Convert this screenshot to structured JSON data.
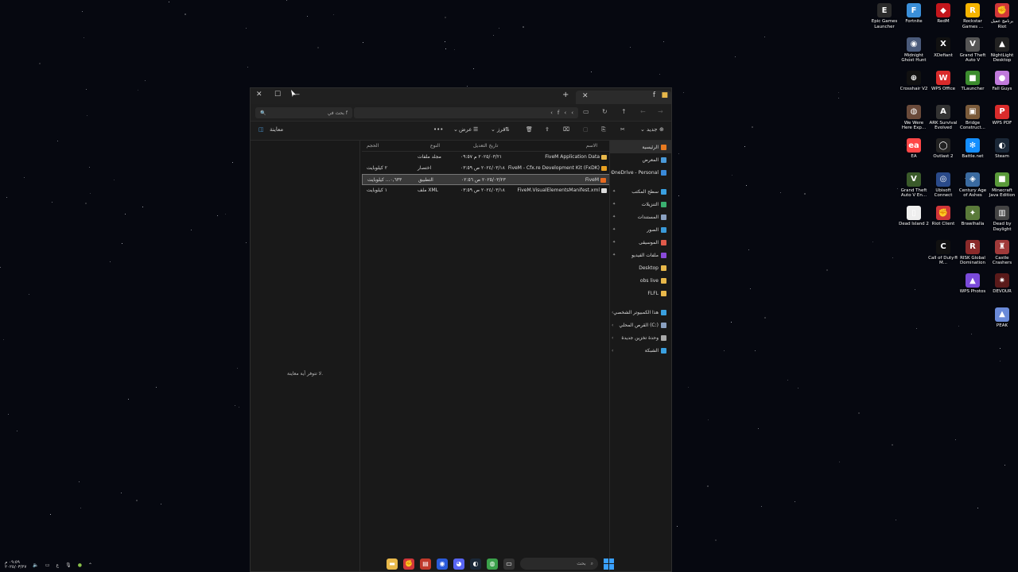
{
  "desktop_icons": [
    {
      "label": "برنامج عميل Riot",
      "icon": "riot-client-icon",
      "color": "#d13639",
      "glyph": "✊"
    },
    {
      "label": "Rockstar Games ...",
      "icon": "rockstar-icon",
      "color": "#f5b400",
      "glyph": "R"
    },
    {
      "label": "RedM",
      "icon": "redm-icon",
      "color": "#c4161c",
      "glyph": "◆"
    },
    {
      "label": "Fortnite",
      "icon": "fortnite-icon",
      "color": "#3a8fd9",
      "glyph": "F"
    },
    {
      "label": "Epic Games Launcher",
      "icon": "epic-games-icon",
      "color": "#2a2a2a",
      "glyph": "E"
    },
    {
      "label": "NightLight Desktop",
      "icon": "nightlight-icon",
      "color": "#222",
      "glyph": "▲"
    },
    {
      "label": "Grand Theft Auto V",
      "icon": "gta-v-icon",
      "color": "#555",
      "glyph": "V"
    },
    {
      "label": "XDefiant",
      "icon": "xdefiant-icon",
      "color": "#111",
      "glyph": "X"
    },
    {
      "label": "Midnight Ghost Hunt",
      "icon": "midnight-ghost-hunt-icon",
      "color": "#4a5a7a",
      "glyph": "◉"
    },
    {
      "label": "Fall Guys",
      "icon": "fall-guys-icon",
      "color": "#c07adb",
      "glyph": "●"
    },
    {
      "label": "TLauncher",
      "icon": "tlauncher-icon",
      "color": "#3c8c2e",
      "glyph": "■"
    },
    {
      "label": "WPS Office",
      "icon": "wps-office-icon",
      "color": "#d92b2b",
      "glyph": "W"
    },
    {
      "label": "Crosshair V2",
      "icon": "crosshair-icon",
      "color": "#111",
      "glyph": "⊕"
    },
    {
      "label": "WPS PDF",
      "icon": "wps-pdf-icon",
      "color": "#d92b2b",
      "glyph": "P"
    },
    {
      "label": "Bridge Construct...",
      "icon": "bridge-constructor-icon",
      "color": "#7a5a3a",
      "glyph": "▣"
    },
    {
      "label": "ARK Survival Evolved",
      "icon": "ark-icon",
      "color": "#333",
      "glyph": "A"
    },
    {
      "label": "We Were Here Exp...",
      "icon": "we-were-here-icon",
      "color": "#6a4a3a",
      "glyph": "◍"
    },
    {
      "label": "Steam",
      "icon": "steam-icon",
      "color": "#1b2838",
      "glyph": "◐"
    },
    {
      "label": "Battle.net",
      "icon": "battlenet-icon",
      "color": "#148eff",
      "glyph": "✻"
    },
    {
      "label": "Outlast 2",
      "icon": "outlast-icon",
      "color": "#222",
      "glyph": "◯"
    },
    {
      "label": "EA",
      "icon": "ea-icon",
      "color": "#ff4747",
      "glyph": "ea"
    },
    {
      "label": "Minecraft Java Edition",
      "icon": "minecraft-icon",
      "color": "#5a9a3a",
      "glyph": "■"
    },
    {
      "label": "Century Age of Ashes",
      "icon": "century-icon",
      "color": "#3a6aa0",
      "glyph": "◈"
    },
    {
      "label": "Ubisoft Connect",
      "icon": "ubisoft-icon",
      "color": "#2a4a8a",
      "glyph": "◎"
    },
    {
      "label": "Grand Theft Auto V En...",
      "icon": "gta-v-enhanced-icon",
      "color": "#3a5a2a",
      "glyph": "V"
    },
    {
      "label": "Dead by Daylight",
      "icon": "dead-by-daylight-icon",
      "color": "#444",
      "glyph": "▥"
    },
    {
      "label": "Brawlhalla",
      "icon": "brawlhalla-icon",
      "color": "#5a7a3a",
      "glyph": "✦"
    },
    {
      "label": "Riot Client",
      "icon": "riot-client-icon",
      "color": "#d13639",
      "glyph": "✊"
    },
    {
      "label": "Dead Island 2",
      "icon": "dead-island-icon",
      "color": "#eee",
      "glyph": "▯"
    },
    {
      "label": "Castle Crashers",
      "icon": "castle-crashers-icon",
      "color": "#a03a3a",
      "glyph": "♜"
    },
    {
      "label": "RISK Global Domination",
      "icon": "risk-icon",
      "color": "#8a2a2a",
      "glyph": "R"
    },
    {
      "label": "Call of Duty® M...",
      "icon": "call-of-duty-icon",
      "color": "#111",
      "glyph": "C"
    },
    {
      "label": "DEVOUR",
      "icon": "devour-icon",
      "color": "#5a1a1a",
      "glyph": "✷"
    },
    {
      "label": "WPS Photos",
      "icon": "wps-photos-icon",
      "color": "#7a4ad9",
      "glyph": "▲"
    },
    {
      "label": "PEAK",
      "icon": "peak-icon",
      "color": "#6a8ad9",
      "glyph": "▲"
    }
  ],
  "window": {
    "close": "✕",
    "maximize": "☐",
    "minimize": "—",
    "new_tab": "+",
    "tab_close": "✕",
    "tab_label": "f",
    "search_placeholder": "بحث في f",
    "search_glyph": "🔍",
    "path": [
      "f",
      "‹"
    ],
    "toolbar": {
      "new": "جديد",
      "sort": "فرز",
      "view": "عرض",
      "more": "•••",
      "preview": "معاينة"
    }
  },
  "file_list": {
    "headers": {
      "name": "الاسم",
      "modified": "تاريخ التعديل",
      "type": "النوع",
      "size": "الحجم"
    },
    "rows": [
      {
        "name": "FiveM Application Data",
        "modified": "٢٠٢٥/٠٣/٢١ م ٠٩:٥٧",
        "type": "مجلد ملفات",
        "size": "",
        "icon_color": "#e8b84a",
        "selected": false
      },
      {
        "name": "FiveM - Cfx.re Development Kit (FxDK)",
        "modified": "٢٠٢٤/٠٣/١٨ ص ٠٣:٥٩",
        "type": "اختصار",
        "size": "٢ كيلوبايت",
        "icon_color": "#e8a020",
        "selected": false
      },
      {
        "name": "FiveM",
        "modified": "٢٠٢٥/٠٣/٢٣ ص ٠٢:٥٦",
        "type": "التطبيق",
        "size": "٠,٦٣٣... كيلوبايت",
        "icon_color": "#e86a20",
        "selected": true
      },
      {
        "name": "FiveM.VisualElementsManifest.xml",
        "modified": "٢٠٢٤/٠٣/١٨ ص ٠٣:٥٩",
        "type": "ملف XML",
        "size": "١ كيلوبايت",
        "icon_color": "#dddddd",
        "selected": false
      }
    ]
  },
  "preview_pane": {
    "message": "لا تتوفر أية معاينة."
  },
  "nav_pane": {
    "top": [
      {
        "label": "الرئيسية",
        "icon": "home-icon",
        "color": "#e87a20",
        "active": true
      },
      {
        "label": "المعرض",
        "icon": "gallery-icon",
        "color": "#4a9ad9",
        "active": false
      },
      {
        "label": "OneDrive - Personal",
        "icon": "onedrive-icon",
        "color": "#3a8ad9",
        "active": false
      }
    ],
    "quick": [
      {
        "label": "سطح المكتب",
        "icon": "desktop-icon",
        "color": "#3aa0e0"
      },
      {
        "label": "التنزيلات",
        "icon": "downloads-icon",
        "color": "#3ab070"
      },
      {
        "label": "المستندات",
        "icon": "documents-icon",
        "color": "#8aa0c0"
      },
      {
        "label": "الصور",
        "icon": "pictures-icon",
        "color": "#3a9ad9"
      },
      {
        "label": "الموسيقى",
        "icon": "music-icon",
        "color": "#e05a4a"
      },
      {
        "label": "ملفات الفيديو",
        "icon": "videos-icon",
        "color": "#8a4ad9"
      },
      {
        "label": "Desktop",
        "icon": "folder-icon",
        "color": "#e8b84a"
      },
      {
        "label": "obs live",
        "icon": "folder-icon",
        "color": "#e8b84a"
      },
      {
        "label": "FLFL",
        "icon": "folder-icon",
        "color": "#e8b84a"
      }
    ],
    "devices": [
      {
        "label": "هذا الكمبيوتر الشخصي",
        "icon": "this-pc-icon",
        "color": "#3aa0e0"
      },
      {
        "label": "القرص المحلي (C:)",
        "icon": "drive-icon",
        "color": "#8aa0c0"
      },
      {
        "label": "وحدة تخزين جديدة",
        "icon": "drive-icon",
        "color": "#aaaaaa"
      },
      {
        "label": "الشبكة",
        "icon": "network-icon",
        "color": "#3aa0e0"
      }
    ],
    "pin_glyph": "✦",
    "chev_glyph": "‹"
  },
  "taskbar": {
    "clock_time": "٠٩:٥٩ م",
    "clock_date": "٢٠٢٥/٠٣/٢٧",
    "language": "ع",
    "search_placeholder": "بحث",
    "apps": [
      {
        "icon": "file-explorer-icon",
        "color": "#e8b84a",
        "glyph": "▬"
      },
      {
        "icon": "riot-icon",
        "color": "#d13639",
        "glyph": "✊"
      },
      {
        "icon": "calendar-icon",
        "color": "#c0392b",
        "glyph": "▤"
      },
      {
        "icon": "browser-icon",
        "color": "#2a5ad9",
        "glyph": "◉"
      },
      {
        "icon": "discord-icon",
        "color": "#5865f2",
        "glyph": "◕"
      },
      {
        "icon": "steam-icon",
        "color": "#1b2838",
        "glyph": "◐"
      },
      {
        "icon": "chrome-icon",
        "color": "#3aa04a",
        "glyph": "◍"
      },
      {
        "icon": "task-view-icon",
        "color": "#333333",
        "glyph": "▭"
      }
    ]
  }
}
